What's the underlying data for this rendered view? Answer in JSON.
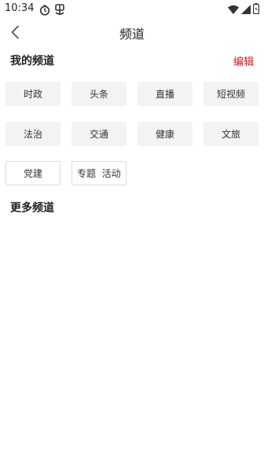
{
  "status_bar": {
    "time": "10:34",
    "icons": [
      "timer-icon",
      "app-notification-icon",
      "wifi-icon",
      "signal-icon",
      "battery-icon"
    ]
  },
  "header": {
    "title": "频道",
    "back_icon": "chevron-left-icon"
  },
  "my_channels": {
    "title": "我的频道",
    "edit_label": "编辑",
    "items": [
      {
        "label": "时政"
      },
      {
        "label": "头条"
      },
      {
        "label": "直播"
      },
      {
        "label": "短视频"
      },
      {
        "label": "法治"
      },
      {
        "label": "交通"
      },
      {
        "label": "健康"
      },
      {
        "label": "文旅"
      },
      {
        "label": "党建"
      },
      {
        "label": "专题  活动"
      }
    ]
  },
  "more_channels": {
    "title": "更多频道"
  },
  "colors": {
    "accent": "#c8161d",
    "chip_bg": "#f3f3f3",
    "chip_border": "#dcdcdc"
  }
}
